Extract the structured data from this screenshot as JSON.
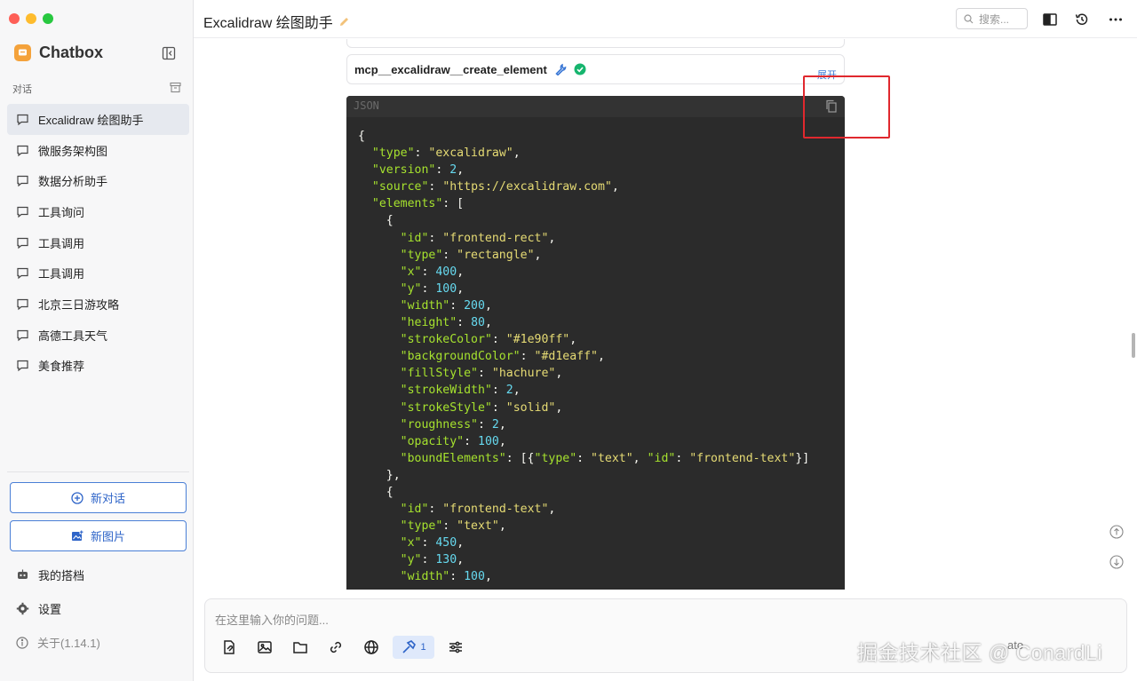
{
  "window": {
    "traffic_colors": [
      "#fe5f57",
      "#febc2e",
      "#28c840"
    ]
  },
  "sidebar": {
    "app_name": "Chatbox",
    "section_label": "对话",
    "conversations": [
      {
        "label": "Excalidraw 绘图助手",
        "active": true
      },
      {
        "label": "微服务架构图"
      },
      {
        "label": "数据分析助手"
      },
      {
        "label": "工具询问"
      },
      {
        "label": "工具调用"
      },
      {
        "label": "工具调用"
      },
      {
        "label": "北京三日游攻略"
      },
      {
        "label": "高德工具天气"
      },
      {
        "label": "美食推荐"
      }
    ],
    "new_chat_label": "新对话",
    "new_image_label": "新图片",
    "my_partner_label": "我的搭档",
    "settings_label": "设置",
    "about_label": "关于(1.14.1)"
  },
  "header": {
    "title": "Excalidraw 绘图助手",
    "search_placeholder": "搜索..."
  },
  "message": {
    "tool_name": "mcp__excalidraw__create_element",
    "expand_label": "展开",
    "code_lang": "JSON"
  },
  "composer": {
    "placeholder": "在这里输入你的问题...",
    "tool_count": "1",
    "trailing_text": "ato"
  },
  "watermark": "掘金技术社区 @ ConardLi",
  "colors": {
    "accent": "#2e64c8",
    "highlight": "#e0282e",
    "code_bg": "#2b2b2b"
  }
}
